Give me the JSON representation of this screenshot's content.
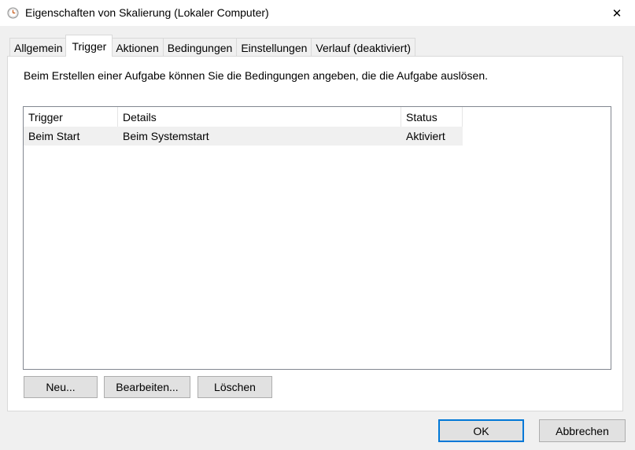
{
  "window": {
    "title": "Eigenschaften von Skalierung (Lokaler Computer)",
    "icon": "task-scheduler-clock-icon",
    "close_symbol": "✕"
  },
  "tabs": [
    {
      "label": "Allgemein",
      "active": false
    },
    {
      "label": "Trigger",
      "active": true
    },
    {
      "label": "Aktionen",
      "active": false
    },
    {
      "label": "Bedingungen",
      "active": false
    },
    {
      "label": "Einstellungen",
      "active": false
    },
    {
      "label": "Verlauf (deaktiviert)",
      "active": false
    }
  ],
  "trigger_tab": {
    "description": "Beim Erstellen einer Aufgabe können Sie die Bedingungen angeben, die die Aufgabe auslösen.",
    "columns": [
      "Trigger",
      "Details",
      "Status"
    ],
    "rows": [
      {
        "trigger": "Beim Start",
        "details": "Beim Systemstart",
        "status": "Aktiviert"
      }
    ],
    "buttons": {
      "new": "Neu...",
      "edit": "Bearbeiten...",
      "delete": "Löschen"
    }
  },
  "dialog_buttons": {
    "ok": "OK",
    "cancel": "Abbrechen"
  },
  "colors": {
    "accent": "#0078d7",
    "selected_row": "#f0f0f0"
  }
}
